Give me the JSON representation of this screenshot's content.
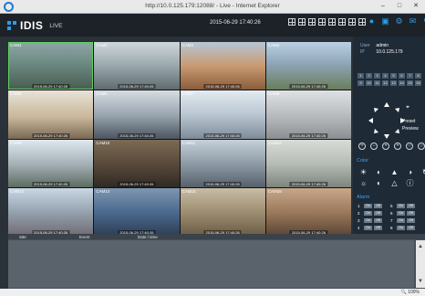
{
  "window": {
    "title": "http://10.0.125.179:12088/ - Live - Internet Explorer"
  },
  "app": {
    "brand": "IDIS",
    "mode": "LIVE",
    "datetime": "2015-06-29 17:40:26",
    "accent": "#2d9be8"
  },
  "layout_buttons": [
    "layout-1x1",
    "layout-2x2",
    "layout-3x3",
    "layout-4x4",
    "layout-5x5",
    "layout-6x6",
    "layout-custom",
    "layout-fullscreen"
  ],
  "toolbar_icons": [
    "user-icon",
    "monitor-icon",
    "settings-icon",
    "chat-icon",
    "search-icon"
  ],
  "cameras": [
    {
      "label": "CAM1",
      "ts": "2015-06-29 17:40:26",
      "selected": true,
      "scene": "aquarium"
    },
    {
      "label": "CAM2",
      "ts": "2015-06-29 17:40:26",
      "selected": false,
      "scene": "lobby"
    },
    {
      "label": "CAM3",
      "ts": "2015-06-29 17:40:26",
      "selected": false,
      "scene": "arches"
    },
    {
      "label": "CAM4",
      "ts": "2015-06-29 17:40:26",
      "selected": false,
      "scene": "plaza"
    },
    {
      "label": "CAM5",
      "ts": "2015-06-29 17:40:26",
      "selected": false,
      "scene": "cafe"
    },
    {
      "label": "CAM6",
      "ts": "2015-06-29 17:40:26",
      "selected": false,
      "scene": "office"
    },
    {
      "label": "CAM7",
      "ts": "2015-06-29 17:40:26",
      "selected": false,
      "scene": "terminal"
    },
    {
      "label": "CAM8",
      "ts": "2015-06-29 17:40:26",
      "selected": false,
      "scene": "hall"
    },
    {
      "label": "CAM9",
      "ts": "2015-06-29 17:40:26",
      "selected": false,
      "scene": "trees"
    },
    {
      "label": "CAM10",
      "ts": "2015-06-29 17:40:26",
      "selected": false,
      "scene": "dusk"
    },
    {
      "label": "CAM11",
      "ts": "2015-06-29 17:40:26",
      "selected": false,
      "scene": "station"
    },
    {
      "label": "CAM12",
      "ts": "2015-06-29 17:40:26",
      "selected": false,
      "scene": "lounge"
    },
    {
      "label": "CAM13",
      "ts": "2015-06-29 17:40:26",
      "selected": false,
      "scene": "walk"
    },
    {
      "label": "CAM14",
      "ts": "2015-06-29 17:40:26",
      "selected": false,
      "scene": "concourse"
    },
    {
      "label": "CAM15",
      "ts": "2015-06-29 17:40:26",
      "selected": false,
      "scene": "corridor"
    },
    {
      "label": "CAM16",
      "ts": "2015-06-29 17:40:26",
      "selected": false,
      "scene": "shelves"
    }
  ],
  "panel": {
    "user_key": "User",
    "user_val": "admin",
    "ip_key": "IP",
    "ip_val": "10.0.125.179",
    "cam_buttons": [
      "1",
      "2",
      "3",
      "4",
      "5",
      "6",
      "7",
      "8",
      "9",
      "10",
      "11",
      "12",
      "13",
      "14",
      "15",
      "16"
    ],
    "preset_label": "Preset",
    "preview_label": "Preview",
    "ptz_controls": [
      "zoom-in-icon",
      "zoom-out-icon",
      "focus-near-icon",
      "focus-far-icon",
      "iris-open-icon",
      "iris-close-icon"
    ],
    "color_title": "Color",
    "color_icons": [
      "brightness-icon",
      "contrast-icon",
      "saturation-icon",
      "hue-icon",
      "refresh-icon",
      "brightness-low-icon",
      "contrast-low-icon",
      "saturation-low-icon",
      "info-icon"
    ],
    "alarm_title": "Alarm",
    "alarms": [
      {
        "n": "1",
        "on": "On",
        "off": "Off"
      },
      {
        "n": "2",
        "on": "On",
        "off": "Off"
      },
      {
        "n": "3",
        "on": "On",
        "off": "Off"
      },
      {
        "n": "4",
        "on": "On",
        "off": "Off"
      },
      {
        "n": "5",
        "on": "On",
        "off": "Off"
      },
      {
        "n": "6",
        "on": "On",
        "off": "Off"
      },
      {
        "n": "7",
        "on": "On",
        "off": "Off"
      },
      {
        "n": "8",
        "on": "On",
        "off": "Off"
      }
    ]
  },
  "events": {
    "col_site": "Site",
    "col_event": "Event",
    "col_datetime": "Date / time"
  },
  "status": {
    "zoom": "100%"
  }
}
